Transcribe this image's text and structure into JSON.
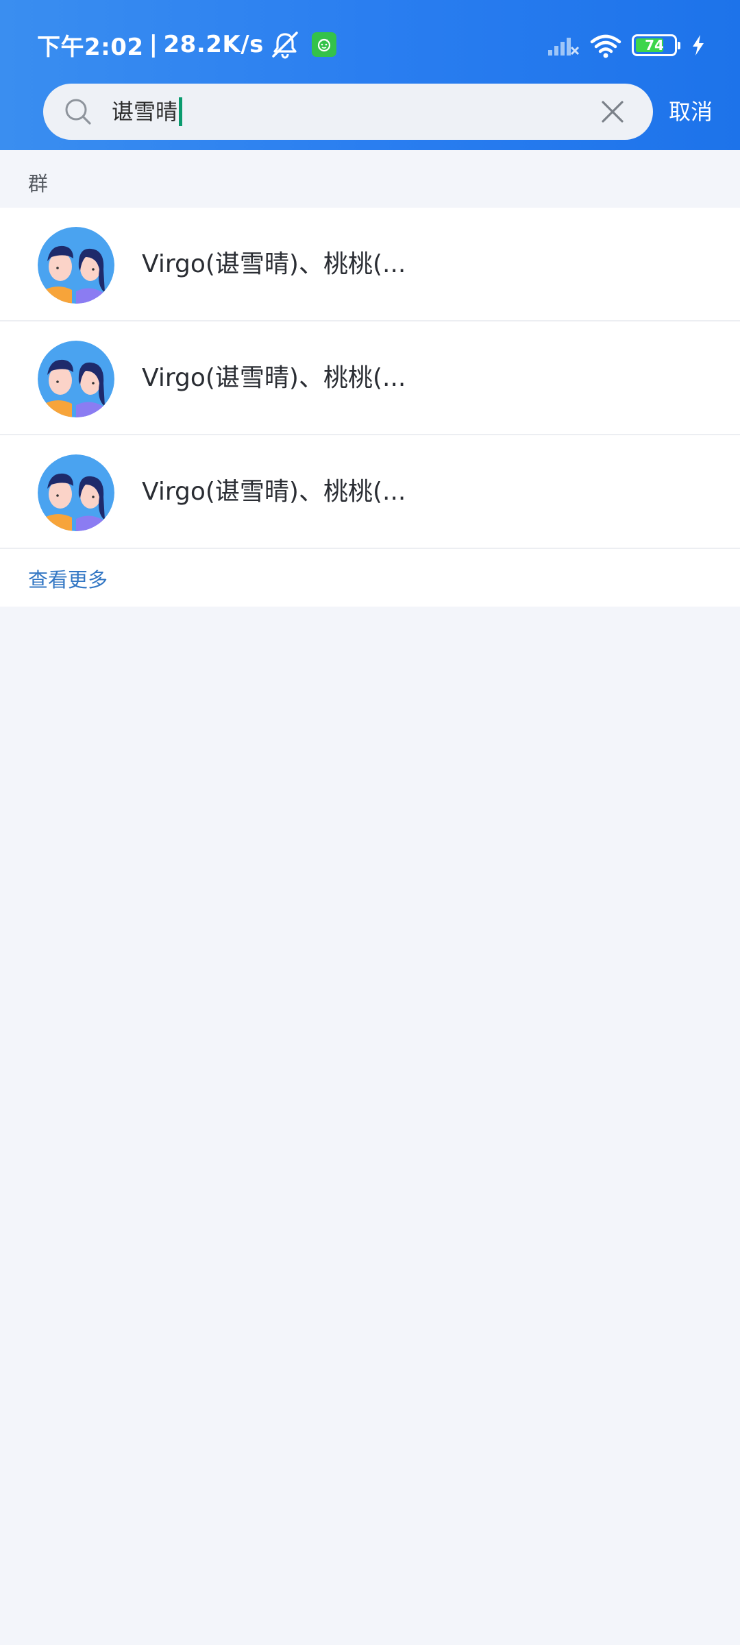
{
  "status_bar": {
    "time": "下午2:02",
    "separator": "|",
    "net_speed": "28.2K/s",
    "battery_level": "74",
    "battery_fraction": 0.74
  },
  "search": {
    "value": "谌雪晴",
    "cancel_label": "取消"
  },
  "section": {
    "label": "群"
  },
  "results": [
    {
      "name": "Virgo(谌雪晴)、桃桃(..."
    },
    {
      "name": "Virgo(谌雪晴)、桃桃(..."
    },
    {
      "name": "Virgo(谌雪晴)、桃桃(..."
    }
  ],
  "more_label": "查看更多",
  "colors": {
    "header": "#2a7ef0",
    "link": "#3377c4",
    "background": "#f3f5fa"
  }
}
